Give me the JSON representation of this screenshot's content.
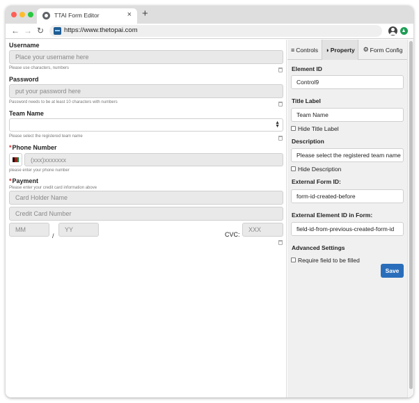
{
  "browser": {
    "tab_title": "TTAI Form Editor",
    "tab_close": "×",
    "new_tab": "+",
    "url": "https://www.thetopai.com"
  },
  "form": {
    "username": {
      "label": "Username",
      "placeholder": "Place your username here",
      "help": "Please use characters, numbers"
    },
    "password": {
      "label": "Password",
      "placeholder": "put your password here",
      "help": "Password needs to be at least 10 characters with numbers"
    },
    "team": {
      "label": "Team Name",
      "value": "",
      "help": "Please select the registered team name"
    },
    "phone": {
      "required_mark": "*",
      "label": "Phone Number",
      "placeholder": "(xxx)xxxxxxx",
      "help": "please enter your phone number"
    },
    "payment": {
      "required_mark": "*",
      "label": "Payment",
      "help": "Please enter your credit card information above",
      "card_holder_placeholder": "Card Holder Name",
      "card_number_placeholder": "Credit Card Number",
      "month_placeholder": "MM",
      "slash": "/",
      "year_placeholder": "YY",
      "cvc_label": "CVC:",
      "cvc_placeholder": "XXX"
    }
  },
  "panel": {
    "tabs": [
      {
        "icon": "≡",
        "label": "Controls"
      },
      {
        "icon": "◑",
        "label": "Property"
      },
      {
        "icon": "⚙",
        "label": "Form Config"
      }
    ],
    "active_tab": "Property",
    "element_id": {
      "label": "Element ID",
      "value": "Control9"
    },
    "title_label": {
      "label": "Title Label",
      "value": "Team Name",
      "hide_label": "Hide Title Label"
    },
    "description": {
      "label": "Description",
      "value": "Please select the registered team name",
      "hide_label": "Hide Description"
    },
    "external_form_id": {
      "label": "External Form ID:",
      "value": "form-id-created-before"
    },
    "external_element_id": {
      "label": "External Element ID in Form:",
      "value": "field-id-from-previous-created-form-id"
    },
    "advanced": {
      "label": "Advanced Settings",
      "require_label": "Require field to be filled"
    },
    "save_label": "Save"
  },
  "colors": {
    "accent": "#2a6ebb",
    "required": "#d9262e"
  }
}
